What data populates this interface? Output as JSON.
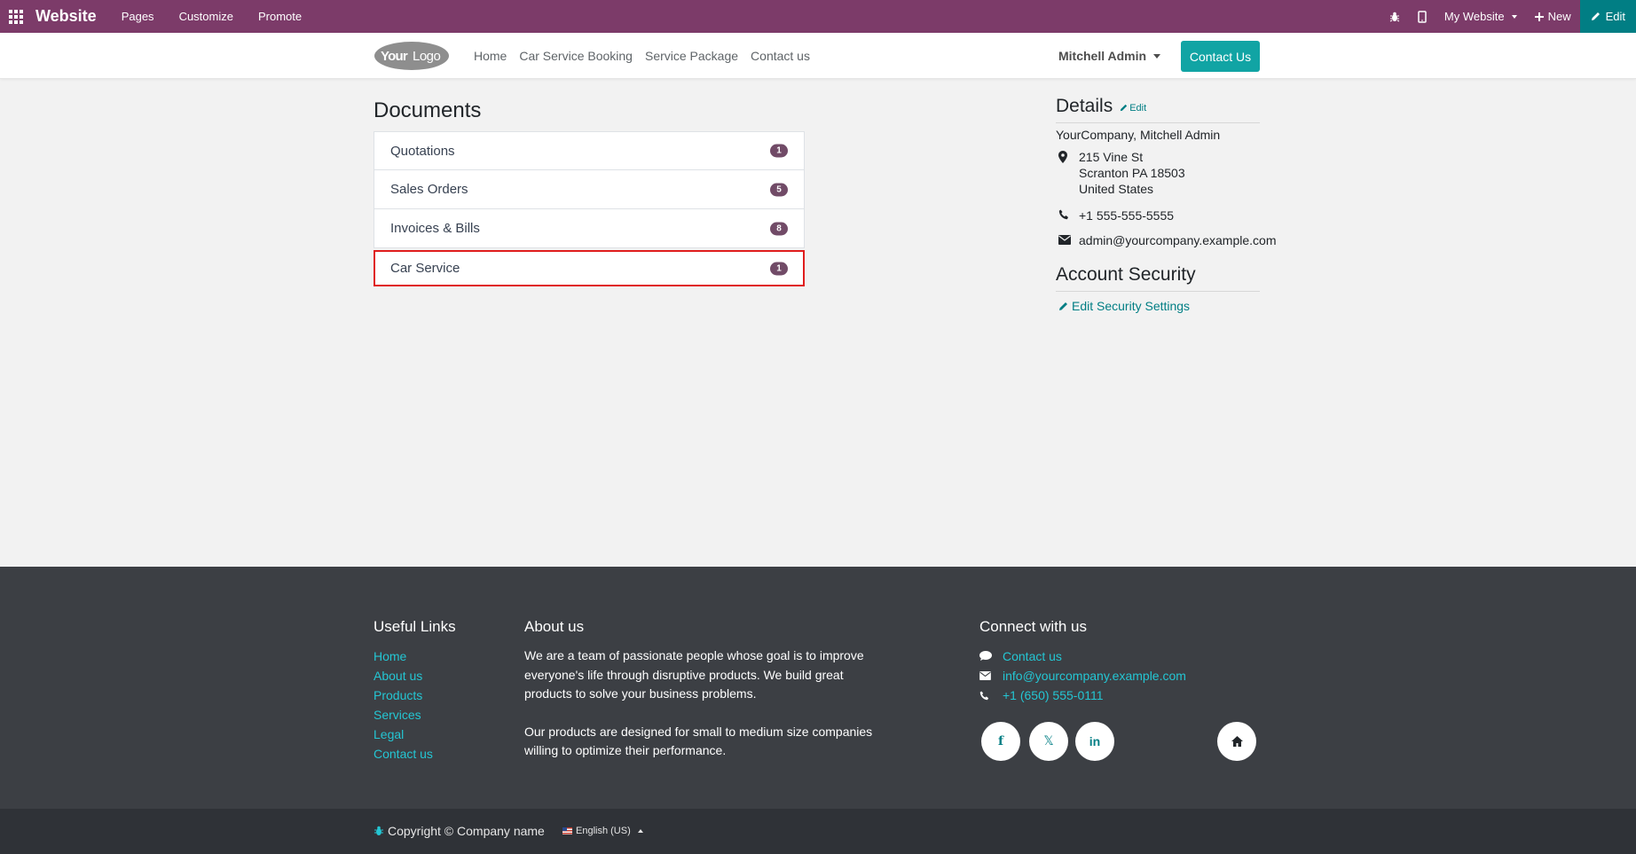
{
  "topbar": {
    "app_name": "Website",
    "menu": [
      "Pages",
      "Customize",
      "Promote"
    ],
    "website_switcher": "My Website",
    "new_label": "New",
    "edit_label": "Edit"
  },
  "header": {
    "logo_text": "YourLogo",
    "nav": [
      "Home",
      "Car Service Booking",
      "Service Package",
      "Contact us"
    ],
    "user_name": "Mitchell Admin",
    "contact_button": "Contact Us"
  },
  "documents": {
    "title": "Documents",
    "items": [
      {
        "label": "Quotations",
        "count": "1"
      },
      {
        "label": "Sales Orders",
        "count": "5"
      },
      {
        "label": "Invoices & Bills",
        "count": "8"
      },
      {
        "label": "Car Service",
        "count": "1"
      }
    ]
  },
  "details": {
    "title": "Details",
    "edit_label": "Edit",
    "company": "YourCompany, Mitchell Admin",
    "address_line1": "215 Vine St",
    "address_line2": "Scranton PA 18503",
    "address_line3": "United States",
    "phone": "+1 555-555-5555",
    "email": "admin@yourcompany.example.com"
  },
  "security": {
    "title": "Account Security",
    "link": "Edit Security Settings"
  },
  "footer": {
    "useful_links_title": "Useful Links",
    "useful_links": [
      "Home",
      "About us",
      "Products",
      "Services",
      "Legal",
      "Contact us"
    ],
    "about_title": "About us",
    "about_p1": "We are a team of passionate people whose goal is to improve everyone's life through disruptive products. We build great products to solve your business problems.",
    "about_p2": "Our products are designed for small to medium size companies willing to optimize their performance.",
    "connect_title": "Connect with us",
    "connect_contact": "Contact us",
    "connect_email": "info@yourcompany.example.com",
    "connect_phone": "+1 (650) 555-0111",
    "social_facebook": "f",
    "social_x": "𝕏",
    "social_linkedin": "in",
    "copyright": "Copyright © Company name",
    "language": "English (US)"
  },
  "colors": {
    "admin_bar": "#7c3b69",
    "accent": "#017e84",
    "badge": "#714b67",
    "highlight_border": "#e01d1d",
    "footer_bg": "#3c3f44"
  }
}
